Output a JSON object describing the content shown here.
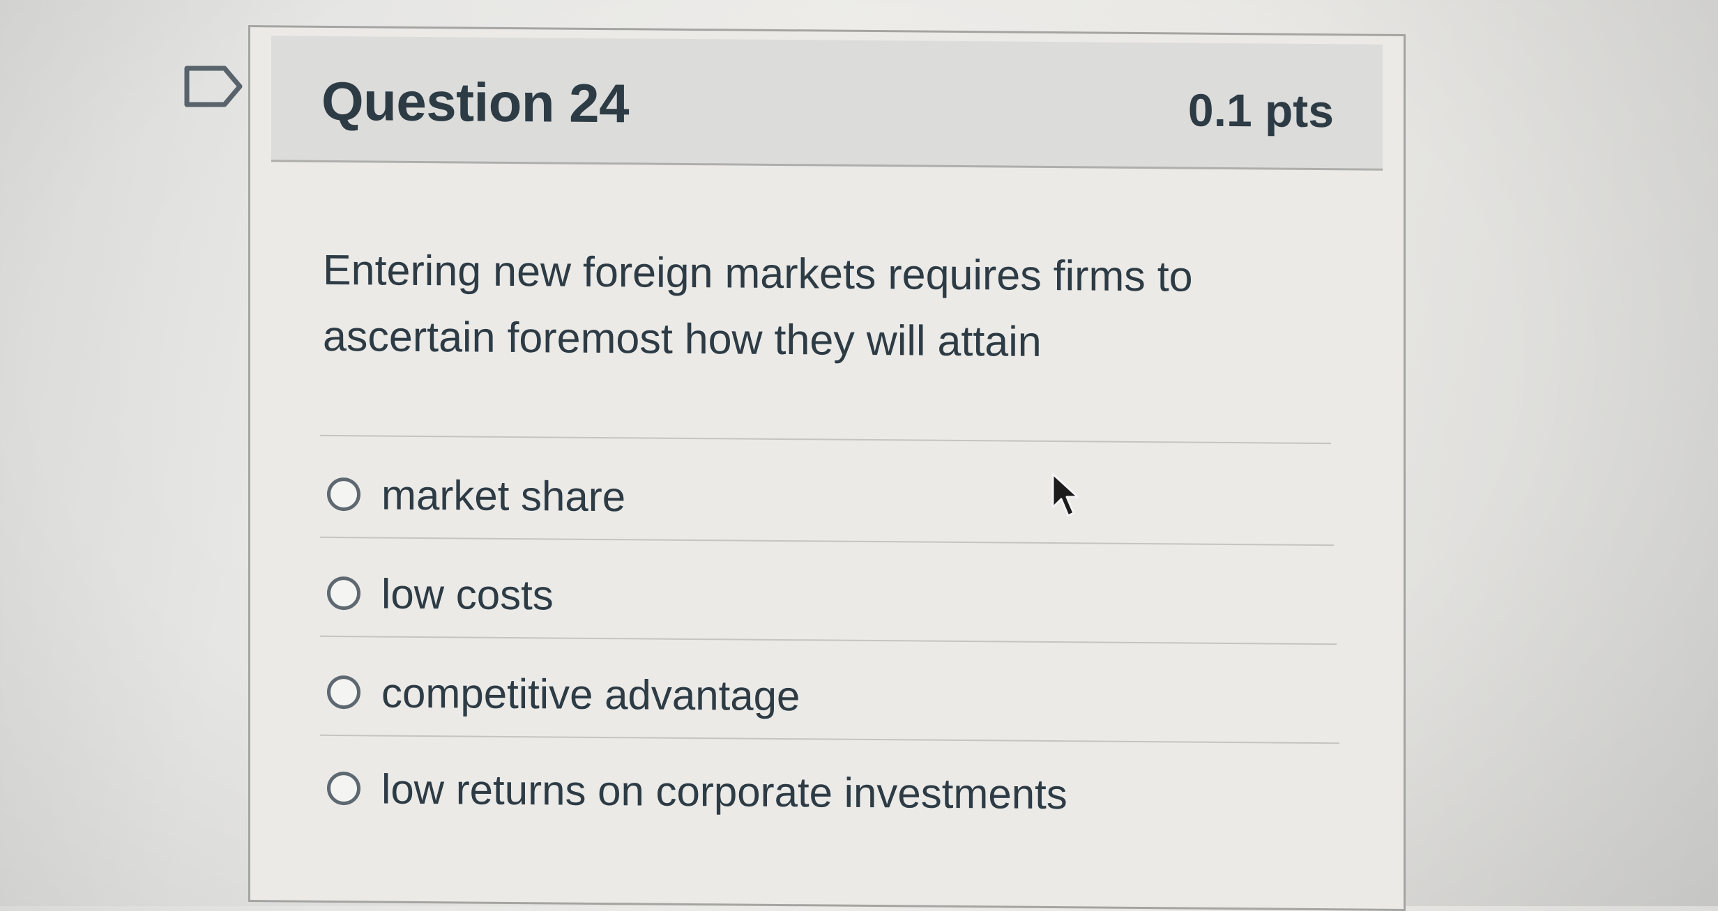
{
  "question": {
    "title": "Question 24",
    "points": "0.1 pts",
    "text": "Entering new foreign markets requires firms to ascertain foremost how they will attain",
    "answers": [
      {
        "label": "market share",
        "selected": false
      },
      {
        "label": "low costs",
        "selected": false
      },
      {
        "label": "competitive advantage",
        "selected": false
      },
      {
        "label": "low returns on corporate investments",
        "selected": false
      }
    ]
  },
  "icons": {
    "flag": "flag-question-icon",
    "cursor": "mouse-pointer-icon"
  },
  "colors": {
    "text": "#2d3b45",
    "header_background": "#dcdcda",
    "card_border": "#a4a4a2"
  }
}
